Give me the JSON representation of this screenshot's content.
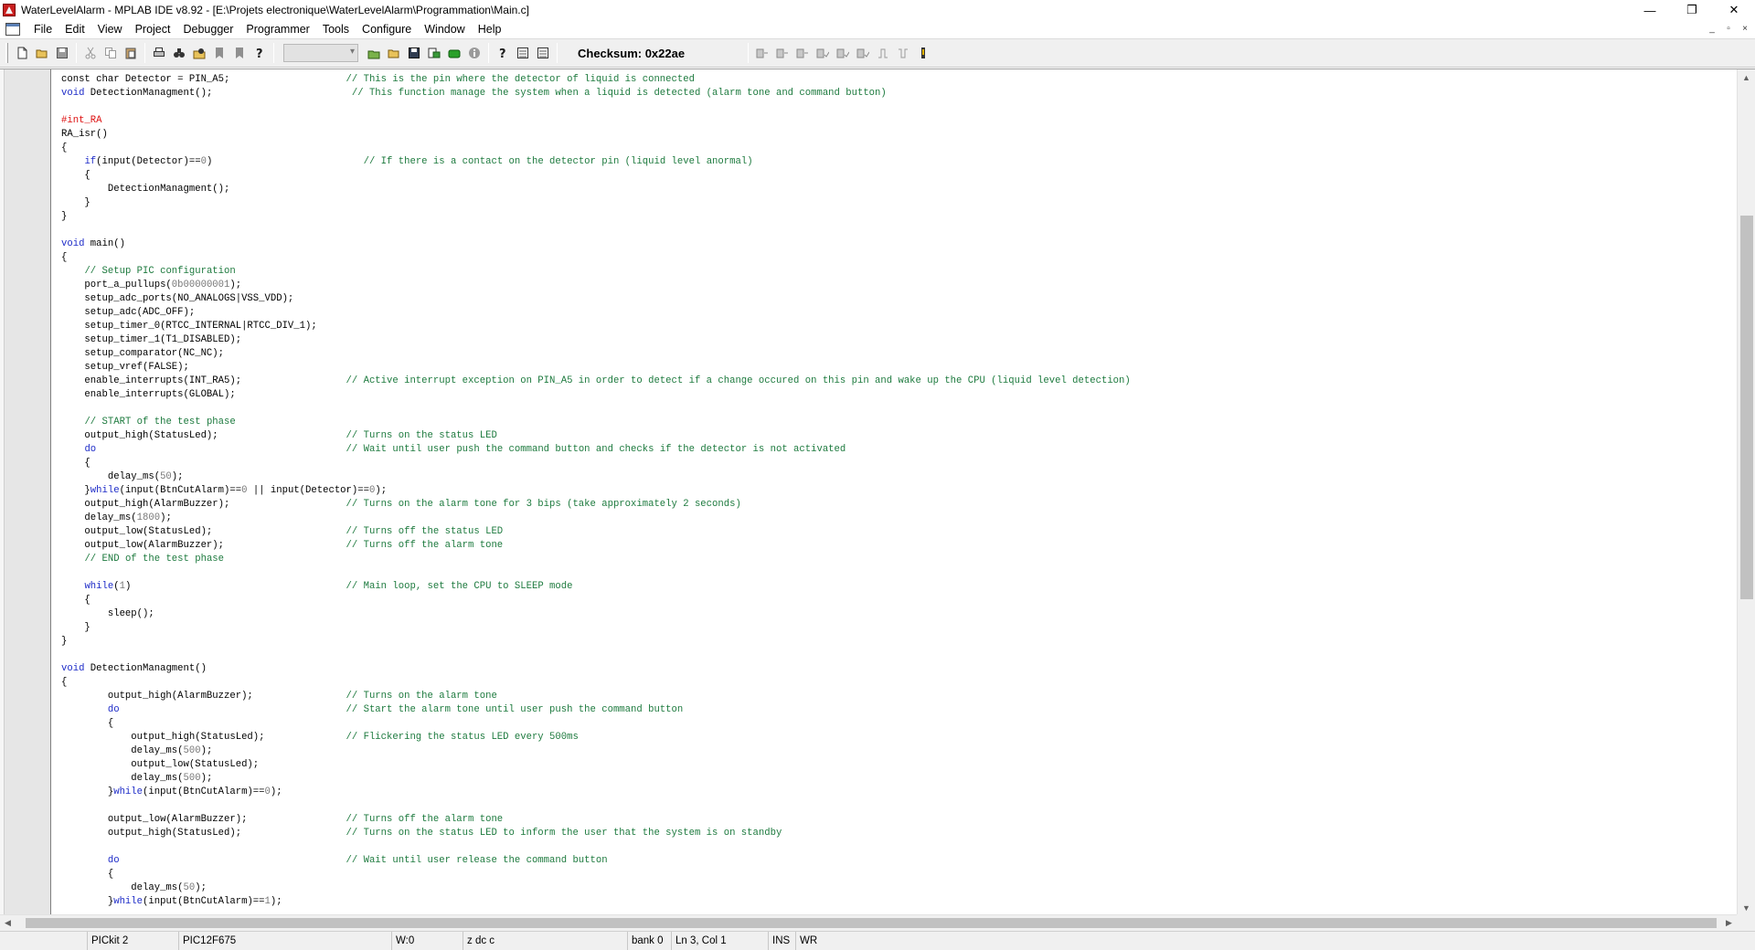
{
  "window": {
    "title": "WaterLevelAlarm - MPLAB IDE v8.92 - [E:\\Projets electronique\\WaterLevelAlarm\\Programmation\\Main.c]",
    "controls": {
      "minimize": "—",
      "restore": "❐",
      "close": "✕"
    }
  },
  "menu": {
    "items": [
      "File",
      "Edit",
      "View",
      "Project",
      "Debugger",
      "Programmer",
      "Tools",
      "Configure",
      "Window",
      "Help"
    ],
    "mdi": {
      "minimize": "_",
      "restore": "▫",
      "close": "×"
    }
  },
  "toolbar": {
    "checksum": "Checksum:  0x22ae",
    "icons": [
      "new-file-icon",
      "open-folder-icon",
      "save-icon",
      "cut-icon",
      "copy-icon",
      "paste-icon",
      "print-icon",
      "find-icon",
      "find-in-files-icon",
      "bookmark-icon",
      "bookmark-prev-icon",
      "help-icon"
    ]
  },
  "editor": {
    "lines": [
      [
        [
          "",
          "const char Detector = PIN_A5;                    "
        ],
        [
          "cm",
          "// This is the pin where the detector of liquid is connected"
        ]
      ],
      [
        [
          "kw",
          "void"
        ],
        [
          "",
          " DetectionManagment();                        "
        ],
        [
          "cm",
          "// This function manage the system when a liquid is detected (alarm tone and command button)"
        ]
      ],
      [
        [
          "",
          ""
        ]
      ],
      [
        [
          "pp",
          "#int_RA"
        ]
      ],
      [
        [
          "",
          "RA_isr()"
        ]
      ],
      [
        [
          "",
          "{"
        ]
      ],
      [
        [
          "",
          "    "
        ],
        [
          "kw",
          "if"
        ],
        [
          "",
          "(input(Detector)=="
        ],
        [
          "num",
          "0"
        ],
        [
          "",
          ")                          "
        ],
        [
          "cm",
          "// If there is a contact on the detector pin (liquid level anormal)"
        ]
      ],
      [
        [
          "",
          "    {"
        ]
      ],
      [
        [
          "",
          "        DetectionManagment();"
        ]
      ],
      [
        [
          "",
          "    }"
        ]
      ],
      [
        [
          "",
          "}"
        ]
      ],
      [
        [
          "",
          ""
        ]
      ],
      [
        [
          "kw",
          "void"
        ],
        [
          "",
          " main()"
        ]
      ],
      [
        [
          "",
          "{"
        ]
      ],
      [
        [
          "",
          "    "
        ],
        [
          "cm",
          "// Setup PIC configuration"
        ]
      ],
      [
        [
          "",
          "    port_a_pullups("
        ],
        [
          "num",
          "0b00000001"
        ],
        [
          "",
          ");"
        ]
      ],
      [
        [
          "",
          "    setup_adc_ports(NO_ANALOGS|VSS_VDD);"
        ]
      ],
      [
        [
          "",
          "    setup_adc(ADC_OFF);"
        ]
      ],
      [
        [
          "",
          "    setup_timer_0(RTCC_INTERNAL|RTCC_DIV_1);"
        ]
      ],
      [
        [
          "",
          "    setup_timer_1(T1_DISABLED);"
        ]
      ],
      [
        [
          "",
          "    setup_comparator(NC_NC);"
        ]
      ],
      [
        [
          "",
          "    setup_vref(FALSE);"
        ]
      ],
      [
        [
          "",
          "    enable_interrupts(INT_RA5);                  "
        ],
        [
          "cm",
          "// Active interrupt exception on PIN_A5 in order to detect if a change occured on this pin and wake up the CPU (liquid level detection)"
        ]
      ],
      [
        [
          "",
          "    enable_interrupts(GLOBAL);"
        ]
      ],
      [
        [
          "",
          ""
        ]
      ],
      [
        [
          "",
          "    "
        ],
        [
          "cm",
          "// START of the test phase"
        ]
      ],
      [
        [
          "",
          "    output_high(StatusLed);                      "
        ],
        [
          "cm",
          "// Turns on the status LED"
        ]
      ],
      [
        [
          "",
          "    "
        ],
        [
          "kw",
          "do"
        ],
        [
          "",
          "                                           "
        ],
        [
          "cm",
          "// Wait until user push the command button and checks if the detector is not activated"
        ]
      ],
      [
        [
          "",
          "    {"
        ]
      ],
      [
        [
          "",
          "        delay_ms("
        ],
        [
          "num",
          "50"
        ],
        [
          "",
          ");"
        ]
      ],
      [
        [
          "",
          "    }"
        ],
        [
          "kw",
          "while"
        ],
        [
          "",
          "(input(BtnCutAlarm)=="
        ],
        [
          "num",
          "0"
        ],
        [
          "",
          " || input(Detector)=="
        ],
        [
          "num",
          "0"
        ],
        [
          "",
          ");"
        ]
      ],
      [
        [
          "",
          "    output_high(AlarmBuzzer);                    "
        ],
        [
          "cm",
          "// Turns on the alarm tone for 3 bips (take approximately 2 seconds)"
        ]
      ],
      [
        [
          "",
          "    delay_ms("
        ],
        [
          "num",
          "1800"
        ],
        [
          "",
          ");"
        ]
      ],
      [
        [
          "",
          "    output_low(StatusLed);                       "
        ],
        [
          "cm",
          "// Turns off the status LED"
        ]
      ],
      [
        [
          "",
          "    output_low(AlarmBuzzer);                     "
        ],
        [
          "cm",
          "// Turns off the alarm tone"
        ]
      ],
      [
        [
          "",
          "    "
        ],
        [
          "cm",
          "// END of the test phase"
        ]
      ],
      [
        [
          "",
          ""
        ]
      ],
      [
        [
          "",
          "    "
        ],
        [
          "kw",
          "while"
        ],
        [
          "",
          "("
        ],
        [
          "num",
          "1"
        ],
        [
          "",
          ")                                     "
        ],
        [
          "cm",
          "// Main loop, set the CPU to SLEEP mode"
        ]
      ],
      [
        [
          "",
          "    {"
        ]
      ],
      [
        [
          "",
          "        sleep();"
        ]
      ],
      [
        [
          "",
          "    }"
        ]
      ],
      [
        [
          "",
          "}"
        ]
      ],
      [
        [
          "",
          ""
        ]
      ],
      [
        [
          "kw",
          "void"
        ],
        [
          "",
          " DetectionManagment()"
        ]
      ],
      [
        [
          "",
          "{"
        ]
      ],
      [
        [
          "",
          "        output_high(AlarmBuzzer);                "
        ],
        [
          "cm",
          "// Turns on the alarm tone"
        ]
      ],
      [
        [
          "",
          "        "
        ],
        [
          "kw",
          "do"
        ],
        [
          "",
          "                                       "
        ],
        [
          "cm",
          "// Start the alarm tone until user push the command button"
        ]
      ],
      [
        [
          "",
          "        {"
        ]
      ],
      [
        [
          "",
          "            output_high(StatusLed);              "
        ],
        [
          "cm",
          "// Flickering the status LED every 500ms"
        ]
      ],
      [
        [
          "",
          "            delay_ms("
        ],
        [
          "num",
          "500"
        ],
        [
          "",
          ");"
        ]
      ],
      [
        [
          "",
          "            output_low(StatusLed);"
        ]
      ],
      [
        [
          "",
          "            delay_ms("
        ],
        [
          "num",
          "500"
        ],
        [
          "",
          ");"
        ]
      ],
      [
        [
          "",
          "        }"
        ],
        [
          "kw",
          "while"
        ],
        [
          "",
          "(input(BtnCutAlarm)=="
        ],
        [
          "num",
          "0"
        ],
        [
          "",
          ");"
        ]
      ],
      [
        [
          "",
          ""
        ]
      ],
      [
        [
          "",
          "        output_low(AlarmBuzzer);                 "
        ],
        [
          "cm",
          "// Turns off the alarm tone"
        ]
      ],
      [
        [
          "",
          "        output_high(StatusLed);                  "
        ],
        [
          "cm",
          "// Turns on the status LED to inform the user that the system is on standby"
        ]
      ],
      [
        [
          "",
          ""
        ]
      ],
      [
        [
          "",
          "        "
        ],
        [
          "kw",
          "do"
        ],
        [
          "",
          "                                       "
        ],
        [
          "cm",
          "// Wait until user release the command button"
        ]
      ],
      [
        [
          "",
          "        {"
        ]
      ],
      [
        [
          "",
          "            delay_ms("
        ],
        [
          "num",
          "50"
        ],
        [
          "",
          ");"
        ]
      ],
      [
        [
          "",
          "        }"
        ],
        [
          "kw",
          "while"
        ],
        [
          "",
          "(input(BtnCutAlarm)=="
        ],
        [
          "num",
          "1"
        ],
        [
          "",
          ");"
        ]
      ]
    ]
  },
  "scrollbars": {
    "up": "▲",
    "down": "▼",
    "left": "◀",
    "right": "▶"
  },
  "status": {
    "debugger": "PICkit 2",
    "device": "PIC12F675",
    "w_reg": "W:0",
    "flags": "z dc c",
    "bank": "bank 0",
    "position": "Ln 3, Col 1",
    "mode": "INS",
    "write": "WR"
  }
}
